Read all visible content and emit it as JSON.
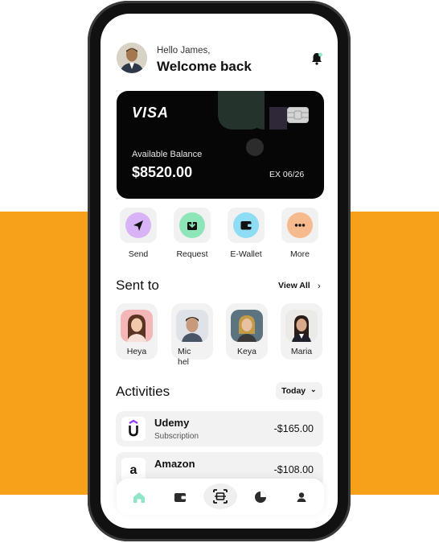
{
  "header": {
    "greeting": "Hello James,",
    "title": "Welcome back"
  },
  "card": {
    "brand": "VISA",
    "balance_label": "Available Balance",
    "balance": "$8520.00",
    "expiry": "EX 06/26"
  },
  "actions": [
    {
      "label": "Send",
      "icon": "send-icon",
      "color": "#D9B3F7"
    },
    {
      "label": "Request",
      "icon": "download-icon",
      "color": "#8EE6B8"
    },
    {
      "label": "E-Wallet",
      "icon": "wallet-icon",
      "color": "#8FDDF5"
    },
    {
      "label": "More",
      "icon": "more-icon",
      "color": "#F7B98E"
    }
  ],
  "sent_to": {
    "title": "Sent to",
    "view_all": "View All",
    "contacts": [
      {
        "name": "Heya"
      },
      {
        "name": "Mic\nhel"
      },
      {
        "name": "Keya"
      },
      {
        "name": "Maria"
      }
    ]
  },
  "activities": {
    "title": "Activities",
    "filter": "Today",
    "items": [
      {
        "name": "Udemy",
        "subtitle": "Subscription",
        "amount": "-$165.00",
        "logo": "U"
      },
      {
        "name": "Amazon",
        "subtitle": "",
        "amount": "-$108.00",
        "logo": "a"
      }
    ]
  },
  "tabbar": {
    "tabs": [
      "home-icon",
      "wallet-icon",
      "scan-icon",
      "chart-icon",
      "profile-icon"
    ],
    "active_color": "#8EE6C8"
  },
  "colors": {
    "accent_orange": "#F7A11A",
    "card_bg": "#060606"
  }
}
